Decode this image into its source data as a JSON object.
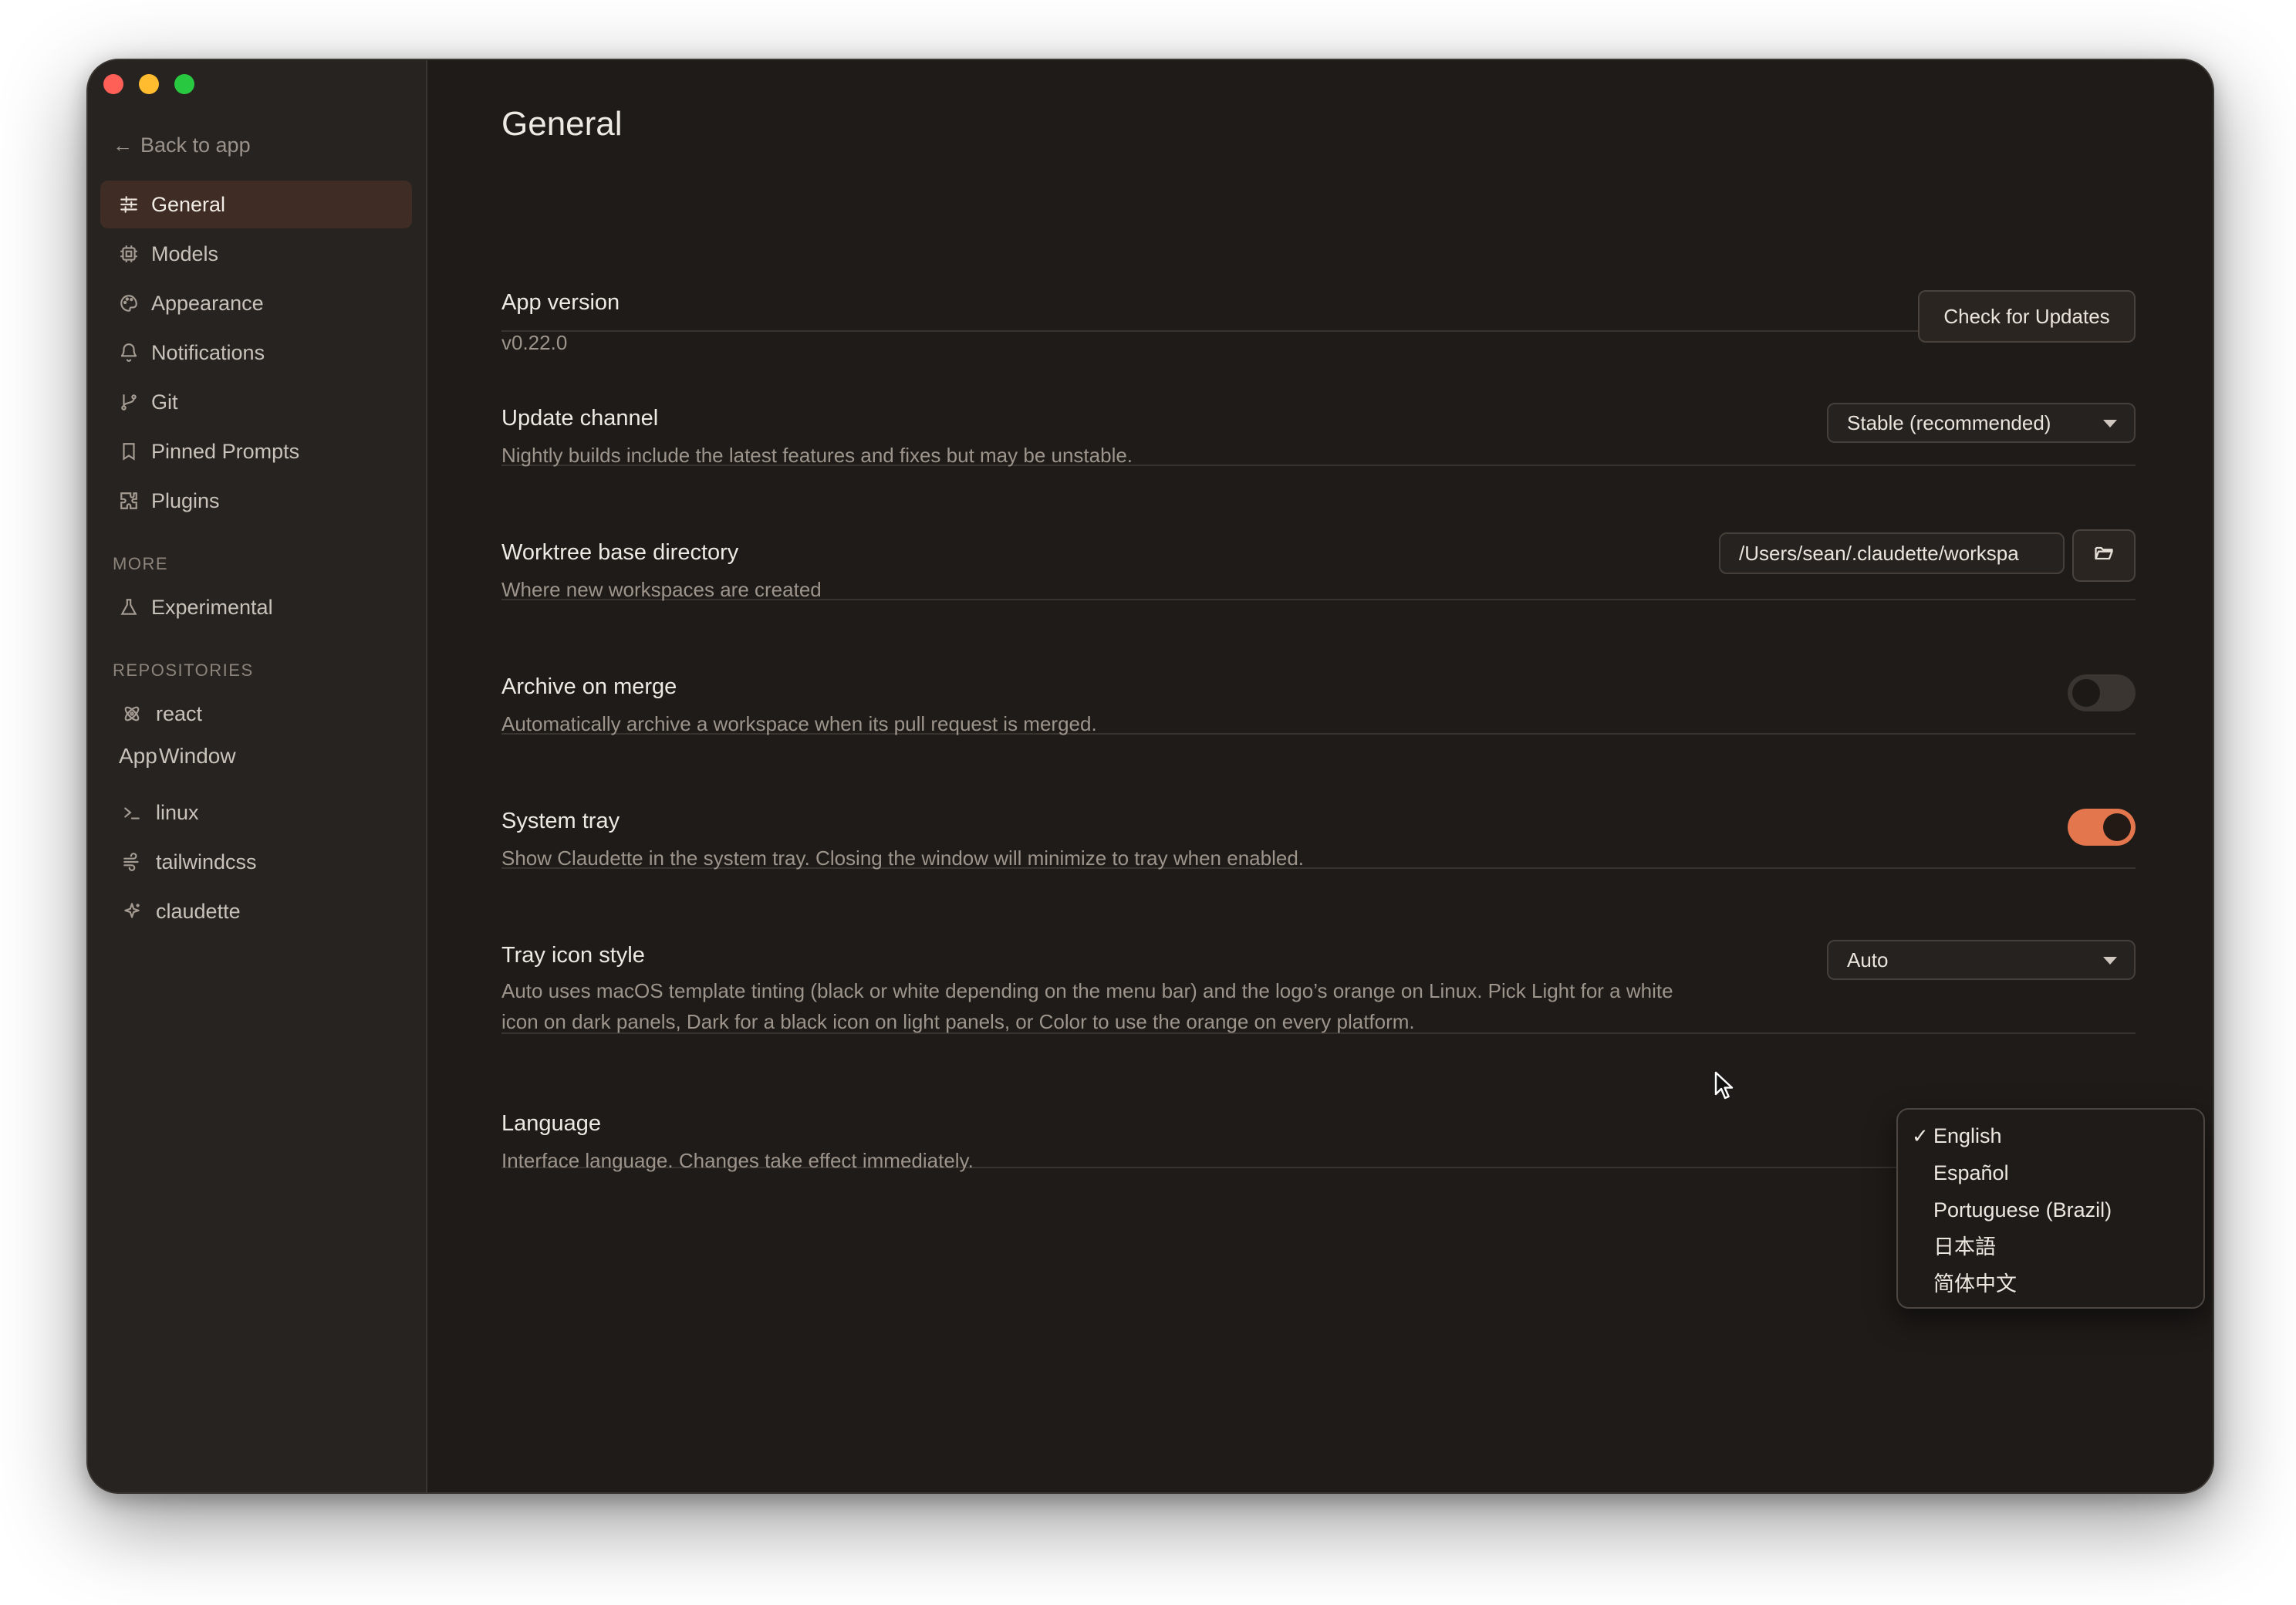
{
  "sidebar": {
    "back_label": "Back to app",
    "nav": [
      {
        "label": "General",
        "icon": "sliders-icon",
        "active": true
      },
      {
        "label": "Models",
        "icon": "cpu-icon"
      },
      {
        "label": "Appearance",
        "icon": "palette-icon"
      },
      {
        "label": "Notifications",
        "icon": "bell-icon"
      },
      {
        "label": "Git",
        "icon": "git-branch-icon"
      },
      {
        "label": "Pinned Prompts",
        "icon": "bookmark-icon"
      },
      {
        "label": "Plugins",
        "icon": "puzzle-icon"
      }
    ],
    "more_label": "MORE",
    "more_items": [
      {
        "label": "Experimental",
        "icon": "flask-icon"
      }
    ],
    "repos_label": "REPOSITORIES",
    "repos": [
      {
        "label": "react",
        "icon": "atom-icon"
      },
      {
        "label": "linux",
        "icon": "terminal-icon"
      },
      {
        "label": "tailwindcss",
        "icon": "wind-icon"
      },
      {
        "label": "claudette",
        "icon": "sparkle-icon"
      }
    ],
    "overlap_text_a": "App",
    "overlap_text_b": "Window"
  },
  "main": {
    "title": "General",
    "app_version": {
      "title": "App version",
      "value": "v0.22.0",
      "button": "Check for Updates"
    },
    "update_channel": {
      "title": "Update channel",
      "desc": "Nightly builds include the latest features and fixes but may be unstable.",
      "selected": "Stable (recommended)"
    },
    "worktree": {
      "title": "Worktree base directory",
      "desc": "Where new workspaces are created",
      "value": "/Users/sean/.claudette/workspa"
    },
    "archive": {
      "title": "Archive on merge",
      "desc": "Automatically archive a workspace when its pull request is merged.",
      "enabled": false
    },
    "tray": {
      "title": "System tray",
      "desc": "Show Claudette in the system tray. Closing the window will minimize to tray when enabled.",
      "enabled": true
    },
    "tray_icon": {
      "title": "Tray icon style",
      "desc_line1": "Auto uses macOS template tinting (black or white depending on the menu bar) and the logo’s orange on Linux. Pick Light for a white",
      "desc_line2": "icon on dark panels, Dark for a black icon on light panels, or Color to use the orange on every platform.",
      "selected": "Auto"
    },
    "language": {
      "title": "Language",
      "desc": "Interface language. Changes take effect immediately.",
      "options": [
        "English",
        "Español",
        "Portuguese (Brazil)",
        "日本語",
        "简体中文"
      ],
      "selected": "English",
      "check": "✓"
    }
  },
  "colors": {
    "accent": "#e3764d",
    "bg": "#1e1b18",
    "sidebar_bg": "#272320",
    "active_nav": "#3e2c25"
  }
}
